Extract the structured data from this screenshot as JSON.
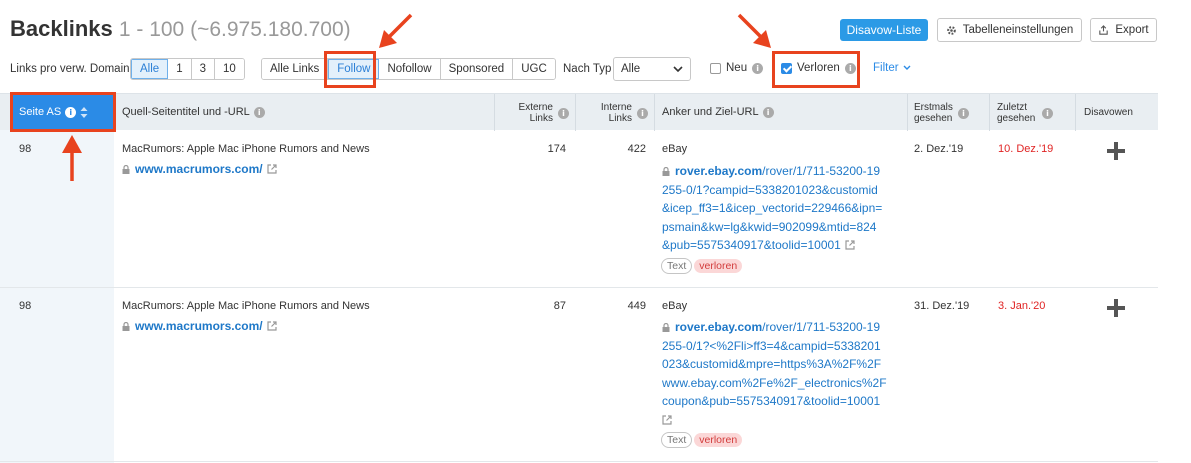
{
  "header": {
    "title": "Backlinks",
    "range": "1 - 100 (~6.975.180.700)",
    "disavow_list": "Disavow-Liste",
    "table_settings": "Tabelleneinstellungen",
    "export": "Export"
  },
  "filters": {
    "links_per_domain_label": "Links pro verw. Domain",
    "links_per_domain_options": [
      "Alle",
      "1",
      "3",
      "10"
    ],
    "link_type_options": [
      "Alle Links",
      "Follow",
      "Nofollow",
      "Sponsored",
      "UGC"
    ],
    "by_type_label": "Nach Typ",
    "by_type_value": "Alle",
    "new_label": "Neu",
    "lost_label": "Verloren",
    "filter_label": "Filter"
  },
  "columns": {
    "page_as": "Seite AS",
    "source": "Quell-Seitentitel und -URL",
    "external_1": "Externe",
    "external_2": "Links",
    "internal_1": "Interne",
    "internal_2": "Links",
    "anchor": "Anker und Ziel-URL",
    "first_seen_1": "Erstmals",
    "first_seen_2": "gesehen",
    "last_seen_1": "Zuletzt",
    "last_seen_2": "gesehen",
    "disavow": "Disavowen"
  },
  "rows": [
    {
      "as": "98",
      "source_title": "MacRumors: Apple Mac iPhone Rumors and News",
      "source_url": "www.macrumors.com/",
      "external": "174",
      "internal": "422",
      "anchor": "eBay",
      "target_domain": "rover.ebay.com",
      "target_lines": [
        "/rover/1/711-53200-19",
        "255-0/1?campid=5338201023&customid",
        "&icep_ff3=1&icep_vectorid=229466&ipn=",
        "psmain&kw=lg&kwid=902099&mtid=824",
        "&pub=5575340917&toolid=10001"
      ],
      "tag_type": "Text",
      "tag_status": "verloren",
      "first_seen": "2. Dez.'19",
      "last_seen": "10. Dez.'19"
    },
    {
      "as": "98",
      "source_title": "MacRumors: Apple Mac iPhone Rumors and News",
      "source_url": "www.macrumors.com/",
      "external": "87",
      "internal": "449",
      "anchor": "eBay",
      "target_domain": "rover.ebay.com",
      "target_lines": [
        "/rover/1/711-53200-19",
        "255-0/1?<%2Fli>ff3=4&campid=5338201",
        "023&customid&mpre=https%3A%2F%2F",
        "www.ebay.com%2Fe%2F_electronics%2F",
        "coupon&pub=5575340917&toolid=10001"
      ],
      "tag_type": "Text",
      "tag_status": "verloren",
      "first_seen": "31. Dez.'19",
      "last_seen": "3. Jan.'20"
    }
  ],
  "colors": {
    "accent": "#2b9ae6",
    "annotation": "#e8431e",
    "lost": "#e02424"
  }
}
